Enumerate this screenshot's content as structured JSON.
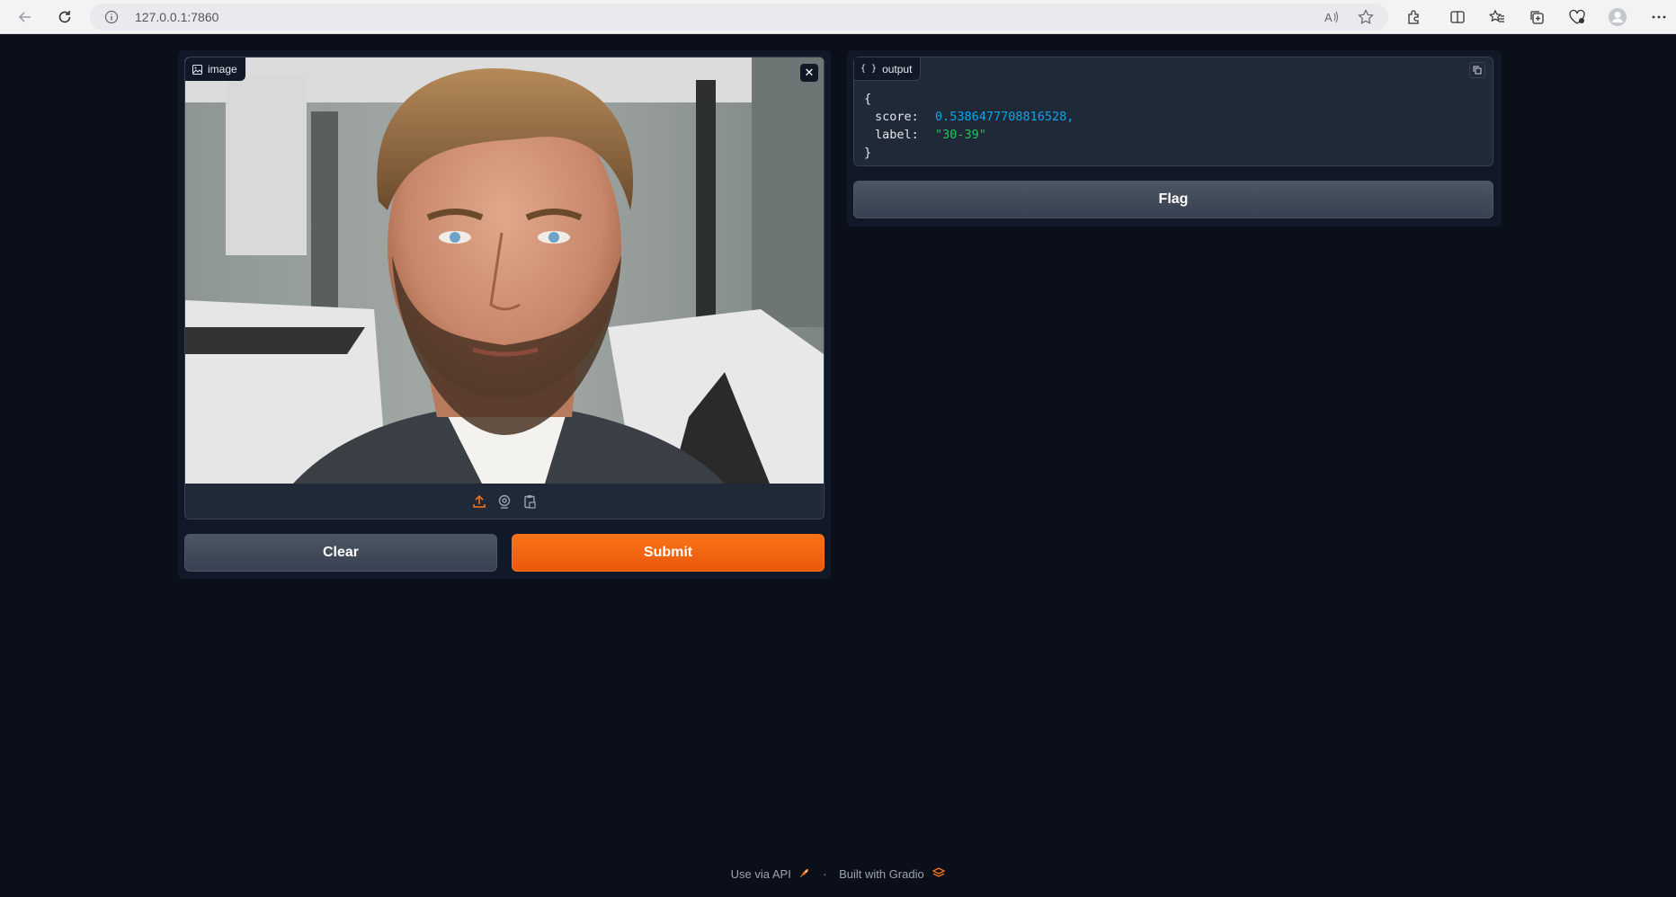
{
  "browser": {
    "url": "127.0.0.1:7860"
  },
  "input_panel": {
    "image_label": "image",
    "clear_label": "Clear",
    "submit_label": "Submit"
  },
  "output_panel": {
    "json_label": "output",
    "json": {
      "open_brace": "{",
      "close_brace": "}",
      "score_key": "score:",
      "score_value": "0.5386477708816528,",
      "label_key": "label:",
      "label_value": "\"30-39\""
    },
    "flag_label": "Flag"
  },
  "footer": {
    "api_link": "Use via API",
    "separator": "·",
    "built_with": "Built with Gradio"
  },
  "colors": {
    "accent": "#f97316",
    "background": "#0b0f19",
    "panel": "#111827",
    "json_number": "#0ea5e9",
    "json_string": "#22c55e"
  }
}
